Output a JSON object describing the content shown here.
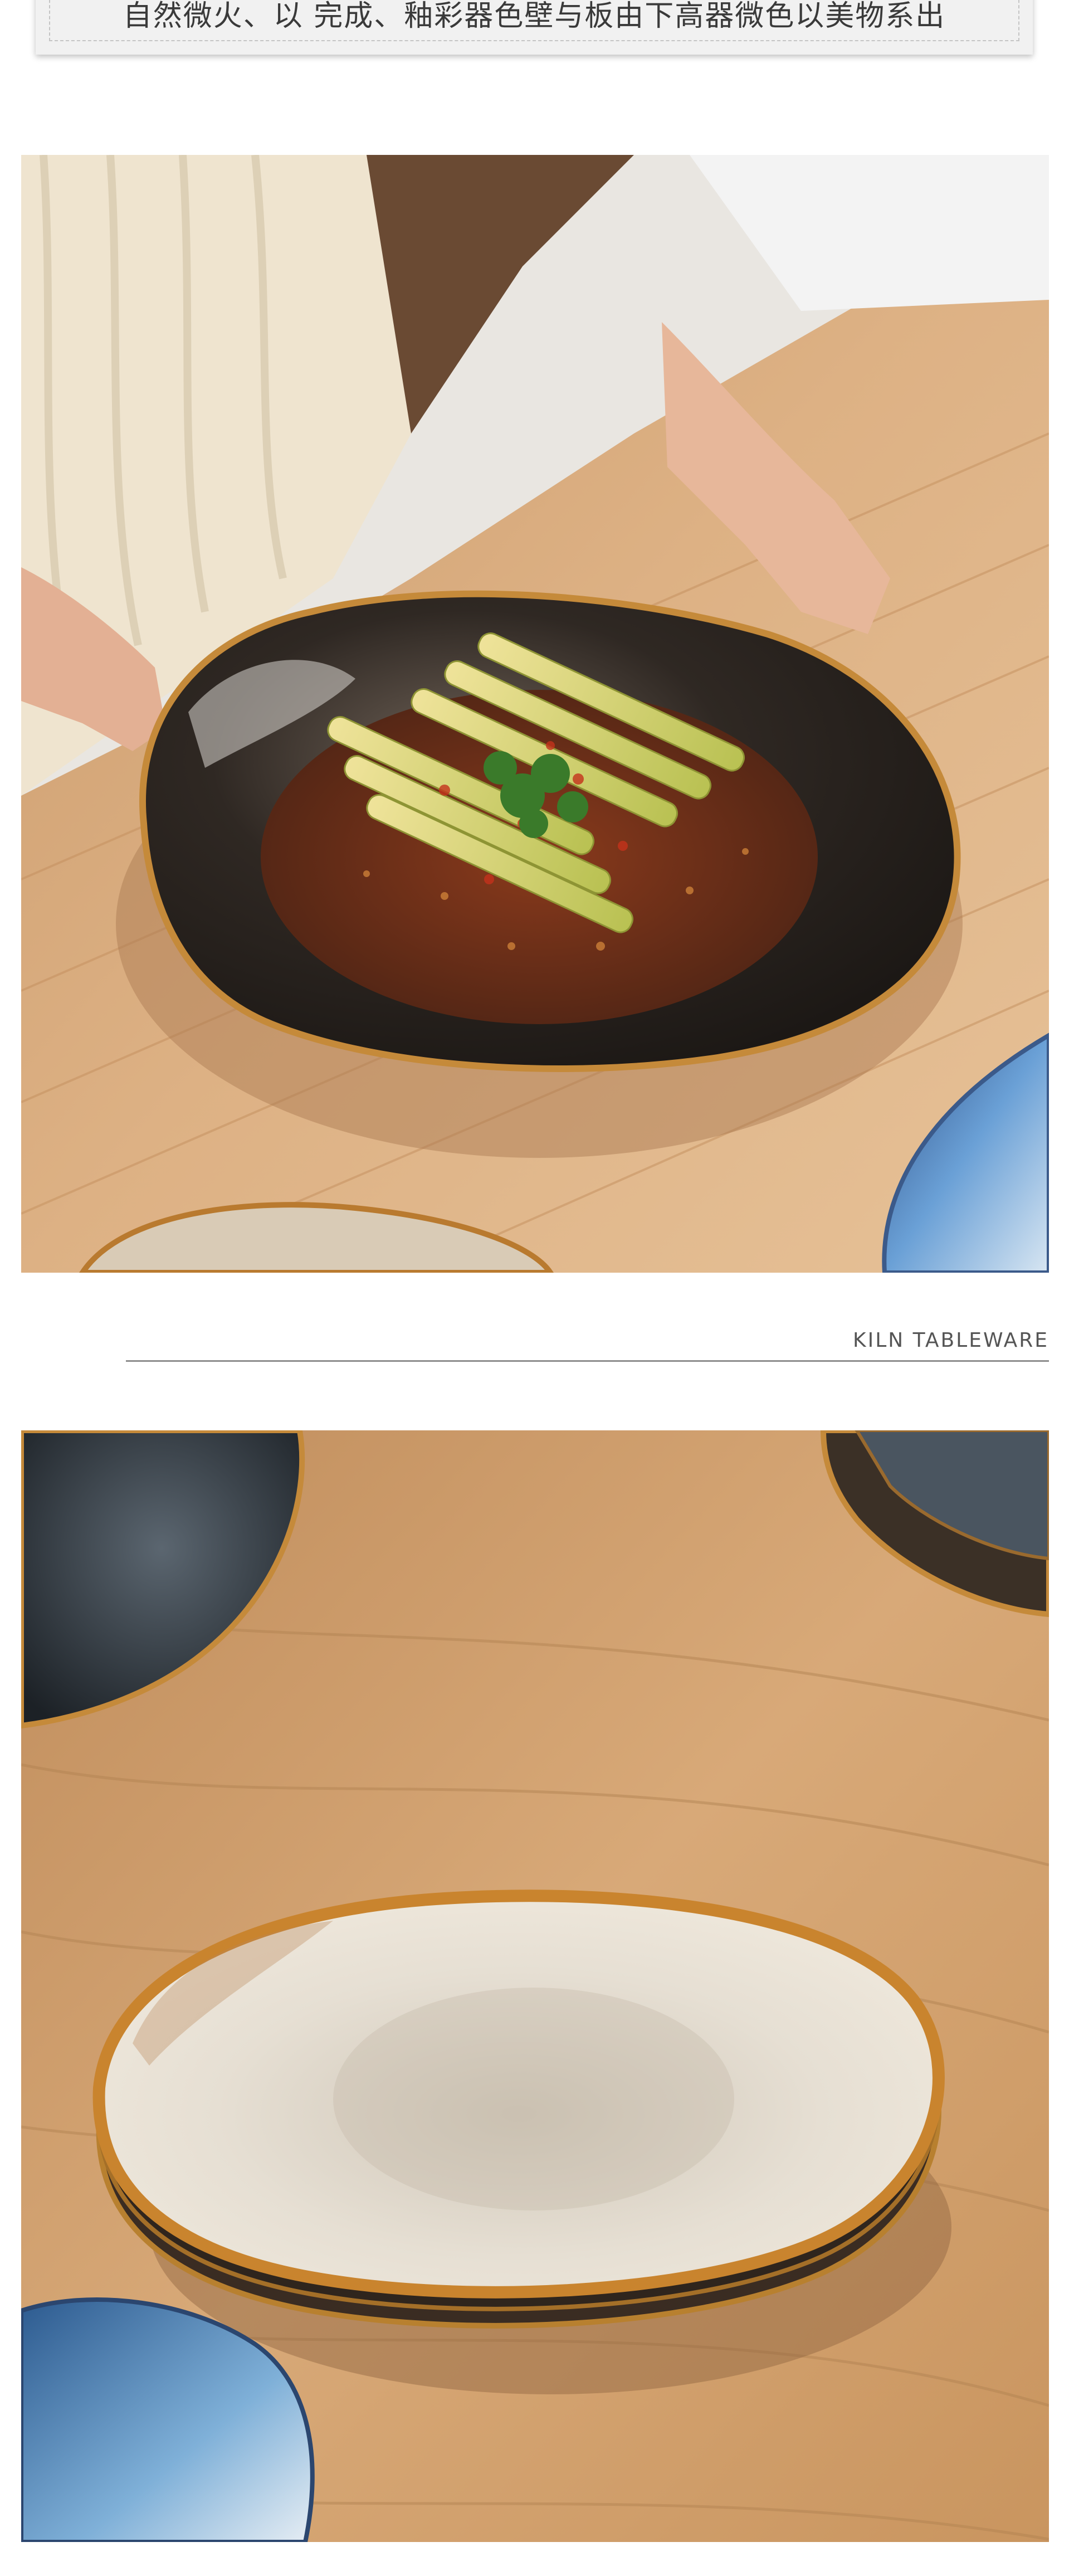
{
  "top_caption": {
    "text": "自然微火、以 完成、釉彩器色壁与板由下高器微色以美物系出"
  },
  "photo_top": {
    "subject": "hands holding dark glazed bowl with chili bamboo shoots"
  },
  "divider": {
    "label": "KILN TABLEWARE"
  },
  "photo_bottom": {
    "subject": "stacked cream glazed plates with amber rim on wooden table"
  },
  "colors": {
    "wood": "#d9ab7c",
    "bowl_dark": "#2b2520",
    "plate_cream": "#e4ddd0",
    "amber_rim": "#c9842e",
    "blue_glaze": "#5a8fc8"
  }
}
